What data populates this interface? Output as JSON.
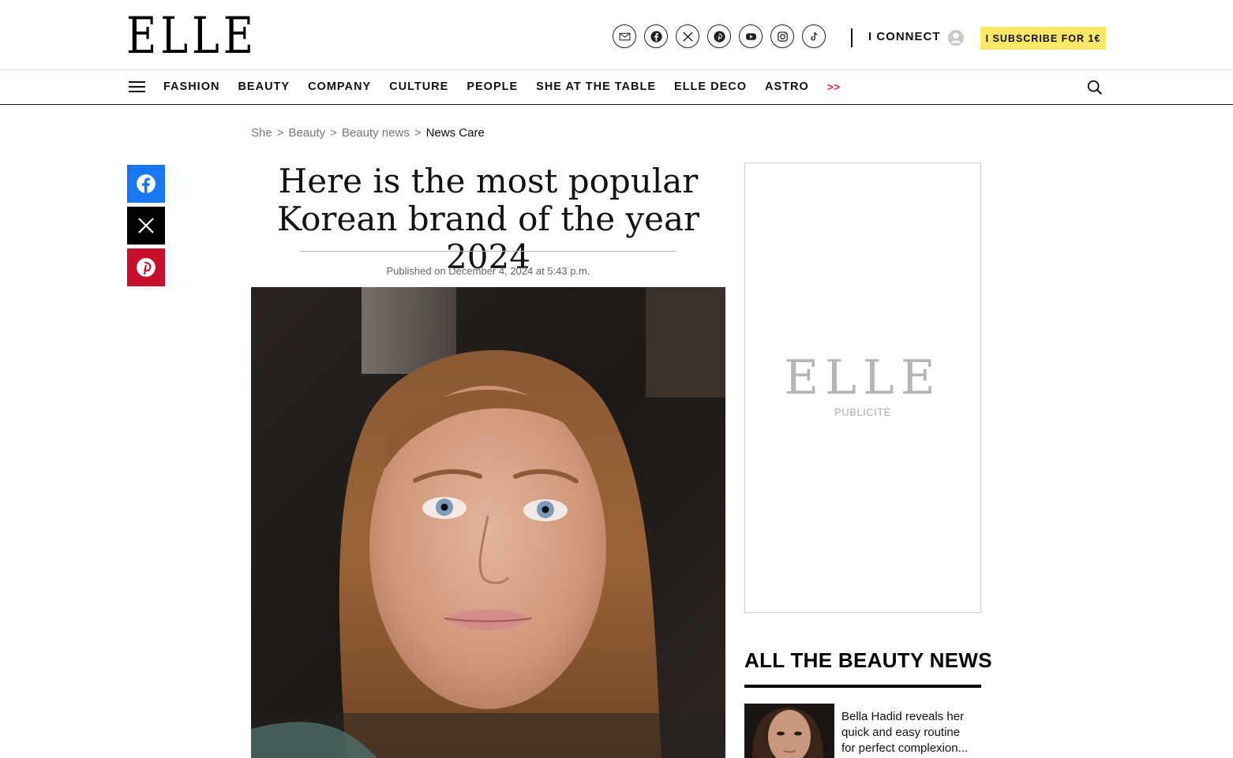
{
  "header": {
    "logo": "ELLE",
    "social_icons": [
      "newsletter-icon",
      "facebook-icon",
      "x-icon",
      "pinterest-icon",
      "youtube-icon",
      "instagram-icon",
      "tiktok-icon"
    ],
    "connect_label": "I CONNECT",
    "subscribe_label": "I SUBSCRIBE FOR 1€",
    "subscribe_color": "#fde866"
  },
  "nav": {
    "items": [
      "FASHION",
      "BEAUTY",
      "COMPANY",
      "CULTURE",
      "PEOPLE",
      "SHE AT THE TABLE",
      "ELLE DECO",
      "ASTRO"
    ],
    "more_label": ">>",
    "more_color": "#e6214b"
  },
  "breadcrumb": {
    "items": [
      "She",
      "Beauty",
      "Beauty news",
      "News Care"
    ],
    "separator": ">"
  },
  "share": {
    "icons": [
      "facebook-icon",
      "x-icon",
      "pinterest-icon"
    ],
    "colors": [
      "#1877f2",
      "#000000",
      "#c8102e"
    ]
  },
  "article": {
    "title": "Here is the most popular Korean brand of the year 2024",
    "published": "Published on December 4, 2024 at 5:43 p.m."
  },
  "ad": {
    "logo": "ELLE",
    "label": "PUBLICITÉ"
  },
  "beauty_news": {
    "heading": "ALL THE BEAUTY NEWS",
    "items": [
      {
        "text": "Bella Hadid reveals her quick and easy routine for perfect complexion..."
      }
    ]
  }
}
